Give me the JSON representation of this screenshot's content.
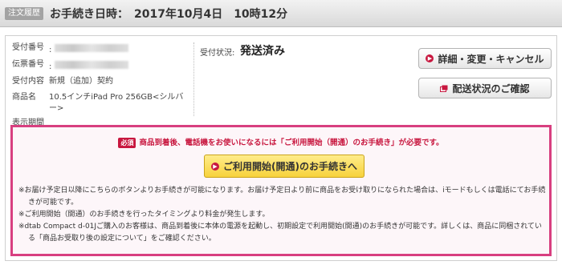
{
  "header": {
    "badge": "注文履歴",
    "title": "お手続き日時：　2017年10月4日　10時12分"
  },
  "info": {
    "receipt_no_label": "受付番号",
    "slip_no_label": "伝票番号",
    "content_label": "受付内容",
    "content_value": "新規（追加）契約",
    "product_label": "商品名",
    "product_value": "10.5インチiPad Pro 256GB<シルバー>",
    "display_period_label": "表示期間"
  },
  "status": {
    "label": "受付状況:",
    "value": "発送済み"
  },
  "buttons": {
    "details": "詳細・変更・キャンセル",
    "shipping": "配送状況のご確認"
  },
  "notice": {
    "required_badge": "必須",
    "required_text": "商品到着後、電話機をお使いになるには「ご利用開始（開通）のお手続き」が必要です。",
    "cta_label": "ご利用開始(開通)のお手続きへ",
    "notes": [
      "※お届け予定日以降にこちらのボタンよりお手続きが可能になります。お届け予定日より前に商品をお受け取りになられた場合は、iモードもしくは電話にてお手続きが可能です。",
      "※ご利用開始（開通）のお手続きを行ったタイミングより料金が発生します。",
      "※dtab Compact d-01Jご購入のお客様は、商品到着後に本体の電源を起動し、初期設定で利用開始(開通)のお手続きが可能です。詳しくは、商品に同梱されている「商品お受取り後の設定について」をご確認ください。"
    ]
  },
  "colors": {
    "accent_red": "#c8173f",
    "notice_border": "#d83f80",
    "cta_yellow": "#f7d23c"
  }
}
